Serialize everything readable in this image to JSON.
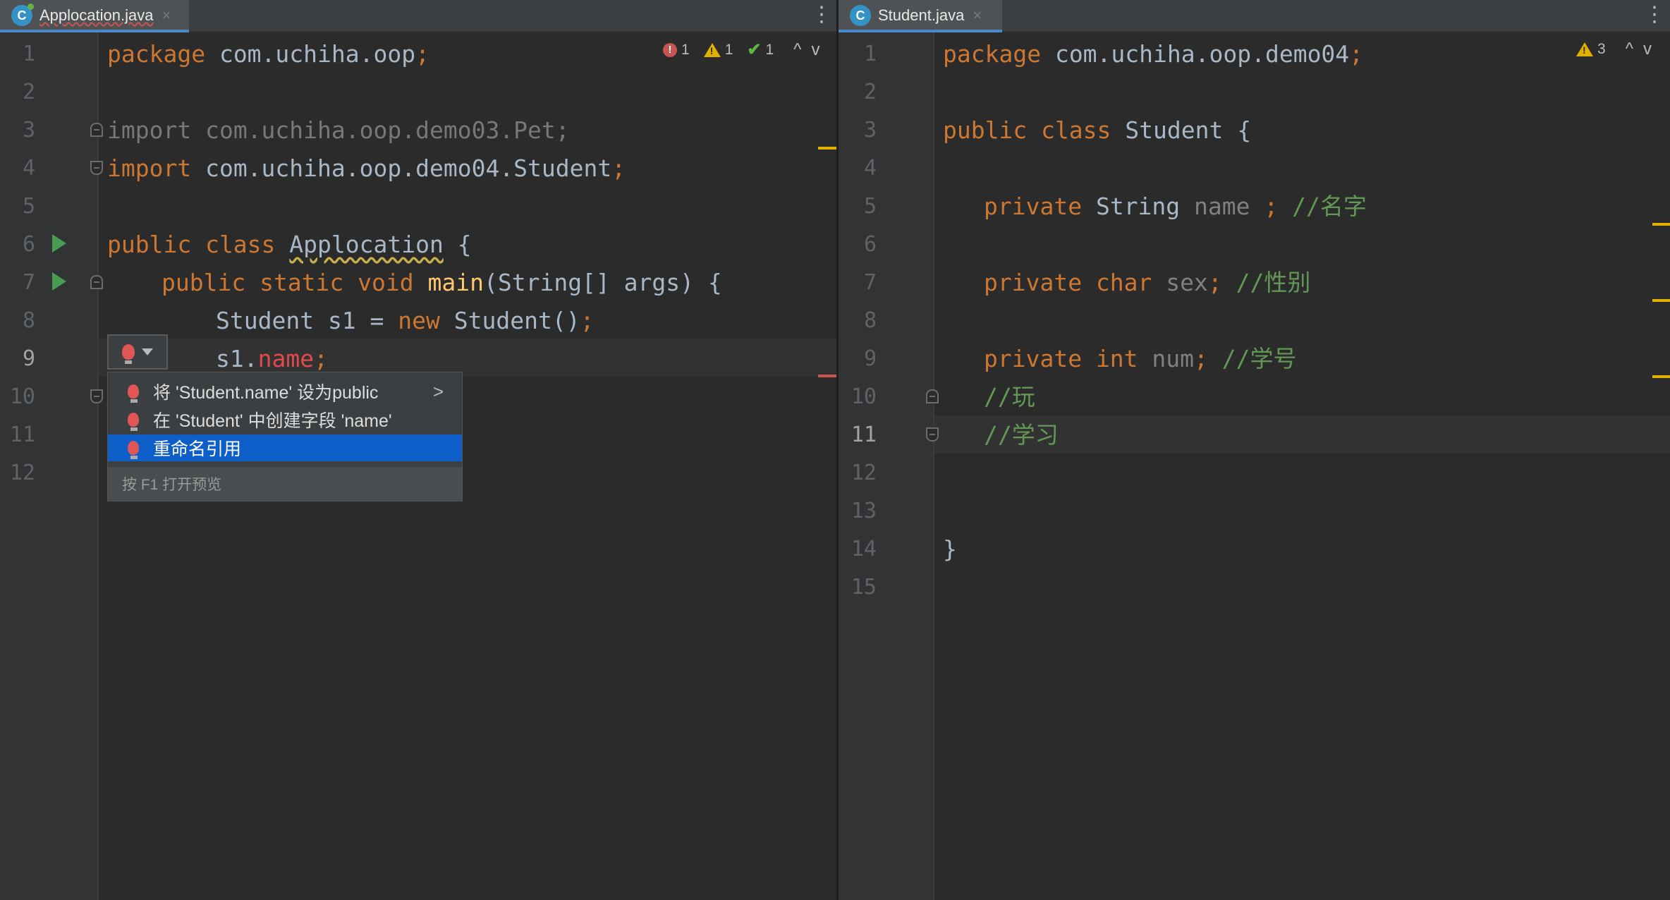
{
  "colors": {
    "keyword": "#cc7832",
    "method": "#ffc66d",
    "comment": "#629755",
    "error": "#e14b4b",
    "warning": "#e0b000",
    "selection": "#0d5ec9",
    "background": "#2b2b2b"
  },
  "left": {
    "tab": {
      "label": "Applocation.java",
      "close": "×",
      "icon": "java-class-icon"
    },
    "menu_glyph": "⋮",
    "inspection": {
      "errors": "1",
      "warnings": "1",
      "ok": "1",
      "up": "^",
      "down": "v"
    },
    "line_numbers": [
      "1",
      "2",
      "3",
      "4",
      "5",
      "6",
      "7",
      "8",
      "9",
      "10",
      "11",
      "12"
    ],
    "lines": {
      "l1_kw": "package",
      "l1_rest": " com.uchiha.oop",
      "l1_semi": ";",
      "l3_kw": "import",
      "l3_rest": " com.uchiha.oop.demo03.Pet;",
      "l4_kw": "import",
      "l4_rest": " com.uchiha.oop.demo04.Student",
      "l4_semi": ";",
      "l6_kw": "public class ",
      "l6_name": "Applocation",
      "l6_rest": " {",
      "l7_kw": "public static void ",
      "l7_fn": "main",
      "l7_rest": "(String[] args) {",
      "l8_a": "Student s1 = ",
      "l8_kw": "new",
      "l8_b": " Student()",
      "l8_semi": ";",
      "l9_a": "s1.",
      "l9_field": "name",
      "l9_semi": ";"
    },
    "popup": {
      "items": [
        {
          "label": "将 'Student.name' 设为public",
          "arrow": ">"
        },
        {
          "label": "在 'Student' 中创建字段 'name'"
        },
        {
          "label": "重命名引用"
        }
      ],
      "footer": "按 F1 打开预览"
    }
  },
  "right": {
    "tab": {
      "label": "Student.java",
      "close": "×",
      "icon": "java-class-icon"
    },
    "menu_glyph": "⋮",
    "inspection": {
      "warnings": "3",
      "up": "^",
      "down": "v"
    },
    "line_numbers": [
      "1",
      "2",
      "3",
      "4",
      "5",
      "6",
      "7",
      "8",
      "9",
      "10",
      "11",
      "12",
      "13",
      "14",
      "15"
    ],
    "lines": {
      "l1_kw": "package",
      "l1_rest": " com.uchiha.oop.demo04",
      "l1_semi": ";",
      "l3_kw": "public class ",
      "l3_rest": "Student {",
      "l5_kw": "private ",
      "l5_type": "String ",
      "l5_field": "name ",
      "l5_semi": "; ",
      "l5_cm": "//名字",
      "l7_kw": "private char ",
      "l7_field": "sex",
      "l7_semi": "; ",
      "l7_cm": "//性别",
      "l9_kw": "private int ",
      "l9_field": "num",
      "l9_semi": "; ",
      "l9_cm": "//学号",
      "l10_cm": "//玩",
      "l11_cm": "//学习",
      "l14": "}"
    }
  }
}
